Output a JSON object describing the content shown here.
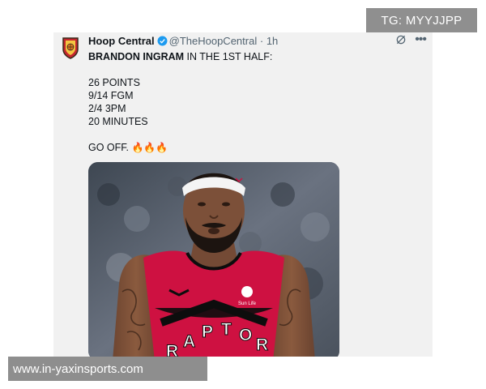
{
  "watermark_top": "TG: MYYJJPP",
  "watermark_bottom": "www.in-yaxinsports.com",
  "tweet": {
    "display_name": "Hoop Central",
    "handle": "@TheHoopCentral",
    "separator": "·",
    "time": "1h",
    "headline_bold": "BRANDON INGRAM",
    "headline_rest": " IN THE 1ST HALF:",
    "stats": [
      "26 POINTS",
      "9/14 FGM",
      "2/4 3PM",
      "20 MINUTES"
    ],
    "closing_text": "GO OFF.",
    "closing_emojis": "🔥🔥🔥"
  },
  "jersey": {
    "letters": [
      "R",
      "A",
      "P",
      "T",
      "O",
      "R"
    ],
    "brand_text": "Sun Life",
    "color": "#ce1141"
  },
  "colors": {
    "verified": "#1d9bf0",
    "text": "#0f1419",
    "muted": "#536471"
  }
}
